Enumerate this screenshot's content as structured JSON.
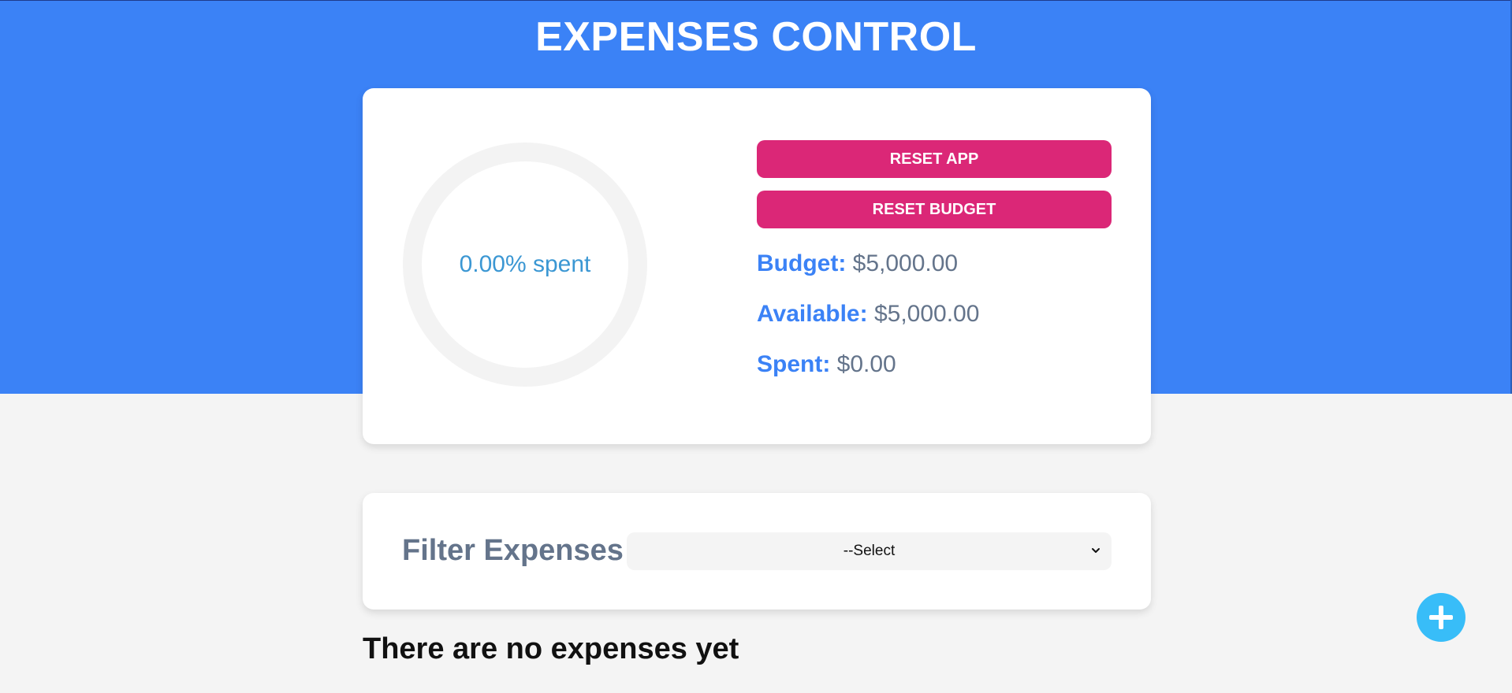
{
  "header": {
    "title": "EXPENSES CONTROL"
  },
  "budget_panel": {
    "progress_percent": 0,
    "progress_label": "0.00% spent",
    "reset_app_label": "RESET APP",
    "reset_budget_label": "RESET BUDGET",
    "budget_key": "Budget:",
    "budget_value": "$5,000.00",
    "available_key": "Available:",
    "available_value": "$5,000.00",
    "spent_key": "Spent:",
    "spent_value": "$0.00"
  },
  "filter": {
    "label": "Filter Expenses",
    "selected_option": "--Select"
  },
  "expenses": {
    "empty_message": "There are no expenses yet"
  },
  "add_button": {
    "icon": "plus-icon"
  },
  "colors": {
    "header_bg": "#3b82f6",
    "page_bg": "#f4f4f4",
    "button_pink": "#db2777",
    "accent_blue": "#3b82f6",
    "progress_text": "#3b97d3",
    "fab_bg": "#38bdf8"
  }
}
